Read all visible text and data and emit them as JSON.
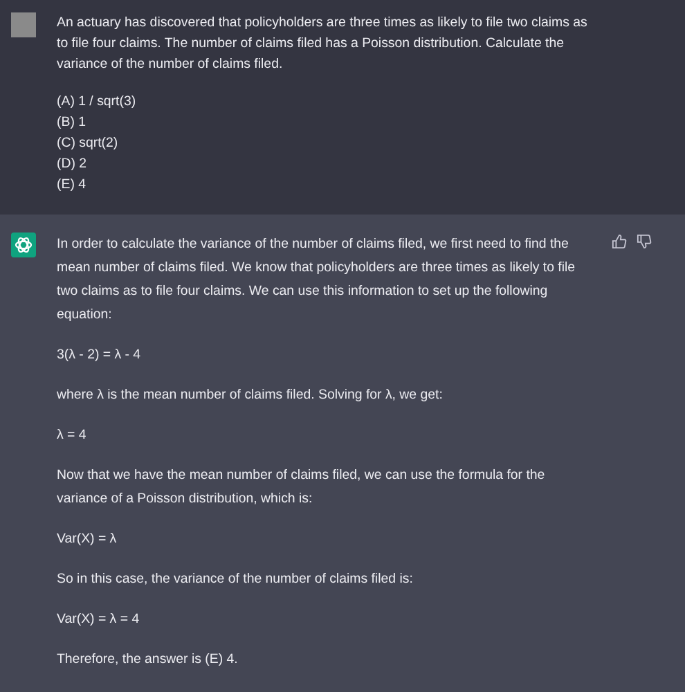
{
  "user_message": {
    "text": "An actuary has discovered that policyholders are three times as likely to file two claims as to file four claims. The number of claims filed has a Poisson distribution. Calculate the variance of the number of claims filed.",
    "options": [
      "(A) 1 / sqrt(3)",
      "(B) 1",
      "(C) sqrt(2)",
      "(D) 2",
      "(E) 4"
    ]
  },
  "assistant_message": {
    "paragraphs": [
      "In order to calculate the variance of the number of claims filed, we first need to find the mean number of claims filed. We know that policyholders are three times as likely to file two claims as to file four claims. We can use this information to set up the following equation:",
      "3(λ - 2) = λ - 4",
      "where λ is the mean number of claims filed. Solving for λ, we get:",
      "λ = 4",
      "Now that we have the mean number of claims filed, we can use the formula for the variance of a Poisson distribution, which is:",
      "Var(X) = λ",
      "So in this case, the variance of the number of claims filed is:",
      "Var(X) = λ = 4",
      "Therefore, the answer is (E) 4."
    ]
  }
}
